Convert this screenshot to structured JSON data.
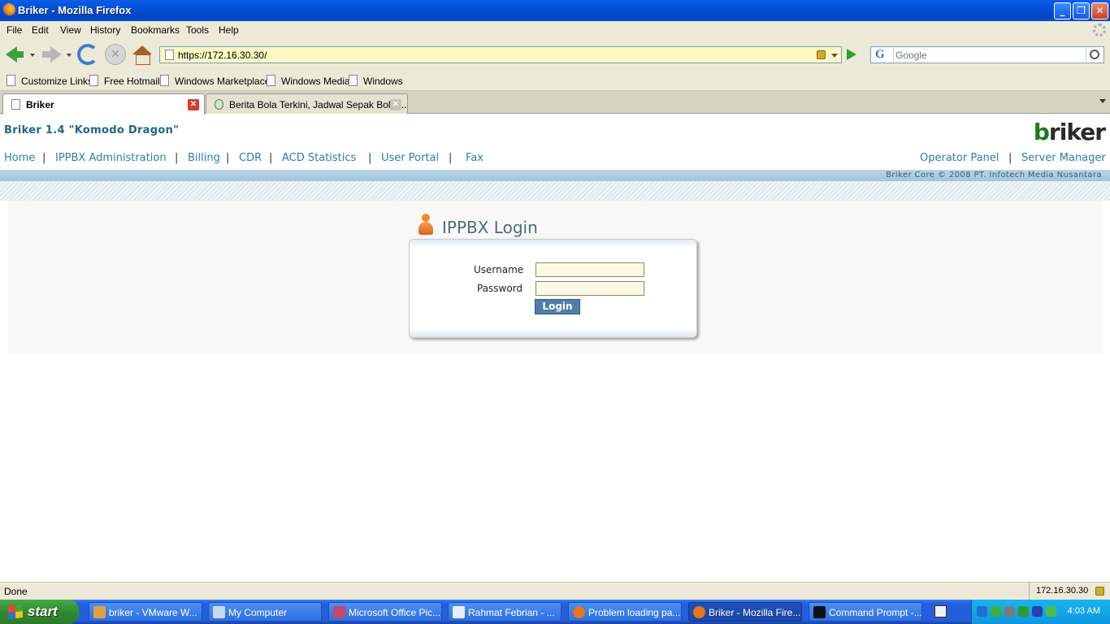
{
  "window": {
    "title": "Briker - Mozilla Firefox"
  },
  "menu": [
    "File",
    "Edit",
    "View",
    "History",
    "Bookmarks",
    "Tools",
    "Help"
  ],
  "address": {
    "url": "https://172.16.30.30/"
  },
  "search": {
    "placeholder": "Google",
    "engine_icon": "G"
  },
  "bookmarks": [
    "Customize Links",
    "Free Hotmail",
    "Windows Marketplace",
    "Windows Media",
    "Windows"
  ],
  "tabs": [
    {
      "label": "Briker",
      "active": true
    },
    {
      "label": "Berita Bola Terkini, Jadwal Sepak Bola,...",
      "active": false
    }
  ],
  "page": {
    "app_title": "Briker 1.4 \"Komodo Dragon\"",
    "logo": {
      "b": "b",
      "r": "riker"
    },
    "nav_left": [
      "Home",
      "IPPBX Administration",
      "Billing",
      "CDR",
      "ACD Statistics",
      "User Portal",
      "Fax"
    ],
    "nav_right": [
      "Operator Panel",
      "Server Manager"
    ],
    "separator": "|",
    "copyright": "Briker Core © 2008 PT. Infotech Media Nusantara",
    "login": {
      "title": "IPPBX Login",
      "username_label": "Username",
      "password_label": "Password",
      "username_value": "",
      "password_value": "",
      "button_label": "Login"
    }
  },
  "status": {
    "text": "Done",
    "ip": "172.16.30.30"
  },
  "taskbar": {
    "start_label": "start",
    "tasks": [
      {
        "label": "briker - VMware W...",
        "icon": "vmware-icon",
        "active": false
      },
      {
        "label": "My Computer",
        "icon": "computer-icon",
        "active": false
      },
      {
        "label": "Microsoft Office Pic...",
        "icon": "office-picture-icon",
        "active": false
      },
      {
        "label": "Rahmat Febrian - ...",
        "icon": "word-icon",
        "active": false
      },
      {
        "label": "Problem loading pa...",
        "icon": "firefox-icon",
        "active": false
      },
      {
        "label": "Briker - Mozilla Fire...",
        "icon": "firefox-icon",
        "active": true
      },
      {
        "label": "Command Prompt -...",
        "icon": "cmd-icon",
        "active": false
      }
    ],
    "clock": "4:03 AM"
  },
  "colors": {
    "link": "#2f7bb0",
    "title": "#23648a",
    "taskbar": "#245edb",
    "start": "#318a31"
  }
}
